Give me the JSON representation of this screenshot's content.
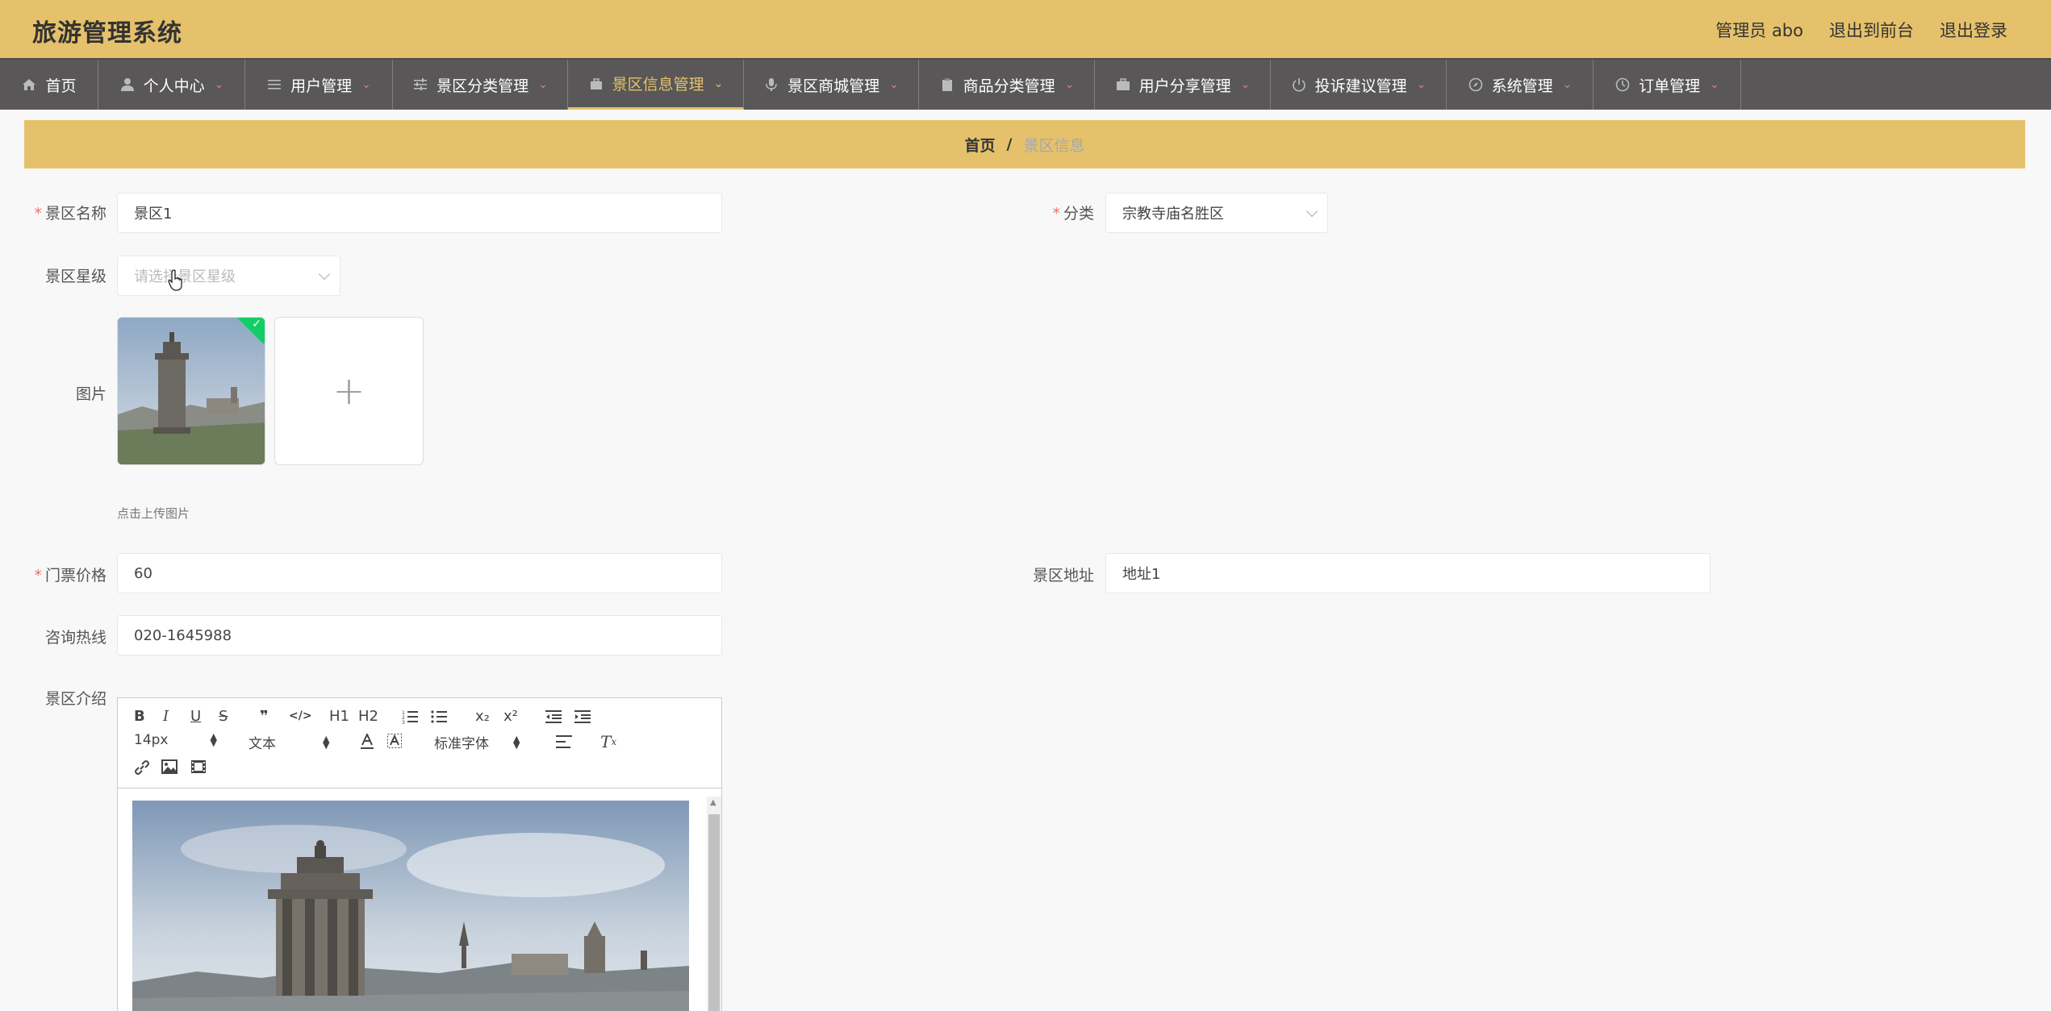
{
  "header": {
    "title": "旅游管理系统",
    "links": [
      "管理员 abo",
      "退出到前台",
      "退出登录"
    ]
  },
  "nav": [
    {
      "label": "首页",
      "icon": "home-icon",
      "has_caret": false,
      "active": false
    },
    {
      "label": "个人中心",
      "icon": "user-icon",
      "has_caret": true,
      "active": false
    },
    {
      "label": "用户管理",
      "icon": "list-icon",
      "has_caret": true,
      "active": false
    },
    {
      "label": "景区分类管理",
      "icon": "sliders-icon",
      "has_caret": true,
      "active": false
    },
    {
      "label": "景区信息管理",
      "icon": "briefcase-icon",
      "has_caret": true,
      "active": true
    },
    {
      "label": "景区商城管理",
      "icon": "microphone-icon",
      "has_caret": true,
      "active": false
    },
    {
      "label": "商品分类管理",
      "icon": "clipboard-icon",
      "has_caret": true,
      "active": false
    },
    {
      "label": "用户分享管理",
      "icon": "suitcase-icon",
      "has_caret": true,
      "active": false
    },
    {
      "label": "投诉建议管理",
      "icon": "power-icon",
      "has_caret": true,
      "active": false
    },
    {
      "label": "系统管理",
      "icon": "compass-icon",
      "has_caret": true,
      "active": false
    },
    {
      "label": "订单管理",
      "icon": "clock-icon",
      "has_caret": true,
      "active": false
    }
  ],
  "breadcrumb": {
    "home": "首页",
    "separator": "/",
    "current": "景区信息"
  },
  "form": {
    "name": {
      "label": "景区名称",
      "value": "景区1",
      "required": "*"
    },
    "category": {
      "label": "分类",
      "value": "宗教寺庙名胜区",
      "required": "*"
    },
    "star": {
      "label": "景区星级",
      "placeholder": "请选择景区星级"
    },
    "image": {
      "label": "图片",
      "upload_tip": "点击上传图片",
      "plus": "+"
    },
    "price": {
      "label": "门票价格",
      "value": "60",
      "required": "*"
    },
    "address": {
      "label": "景区地址",
      "value": "地址1"
    },
    "hotline": {
      "label": "咨询热线",
      "value": "020-1645988"
    },
    "intro": {
      "label": "景区介绍"
    }
  },
  "editor": {
    "font_size": "14px",
    "block_format": "文本",
    "font_family": "标准字体",
    "buttons": [
      "B",
      "I",
      "U",
      "S",
      "❞",
      "</>",
      "H1",
      "H2",
      "ordered-list",
      "bullet-list",
      "x₂",
      "x²",
      "outdent",
      "indent",
      "color",
      "background",
      "align",
      "clean",
      "link",
      "image",
      "video"
    ]
  }
}
